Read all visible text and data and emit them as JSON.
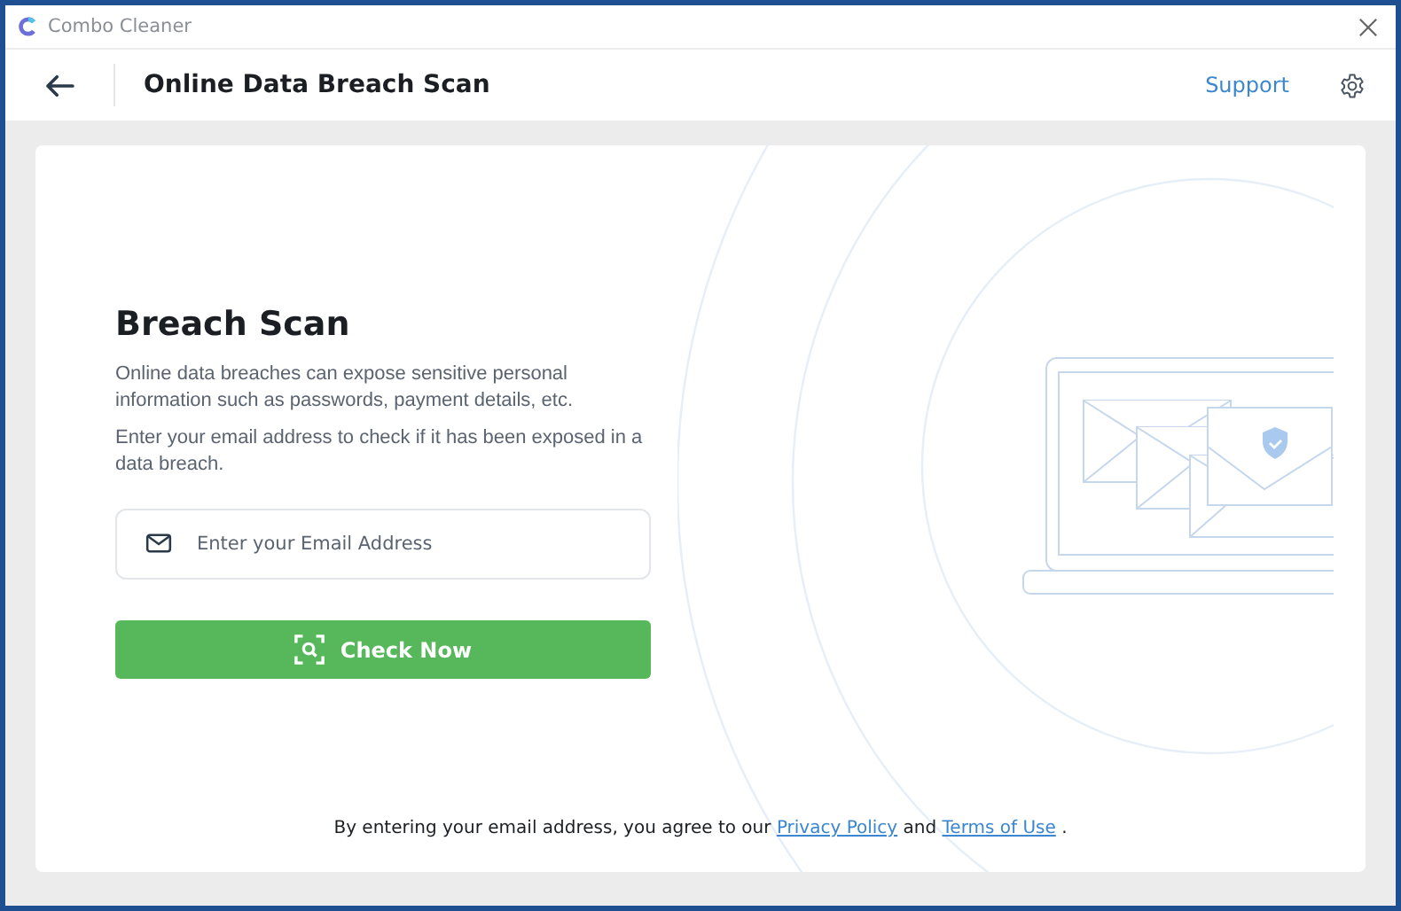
{
  "window": {
    "title": "Combo Cleaner"
  },
  "header": {
    "title": "Online Data Breach Scan",
    "support_link": "Support"
  },
  "scan": {
    "heading": "Breach Scan",
    "paragraphs": [
      "Online data breaches can expose sensitive personal information such as passwords, payment details, etc.",
      "Enter your email address to check if it has been exposed in a data breach."
    ],
    "email_field": {
      "placeholder": "Enter your Email Address"
    },
    "button": "Check Now"
  },
  "consent": {
    "before": "By entering your email address, you agree to our",
    "privacy_link": "Privacy Policy",
    "middle": "and",
    "terms_link": "Terms of Use",
    "after": "."
  }
}
